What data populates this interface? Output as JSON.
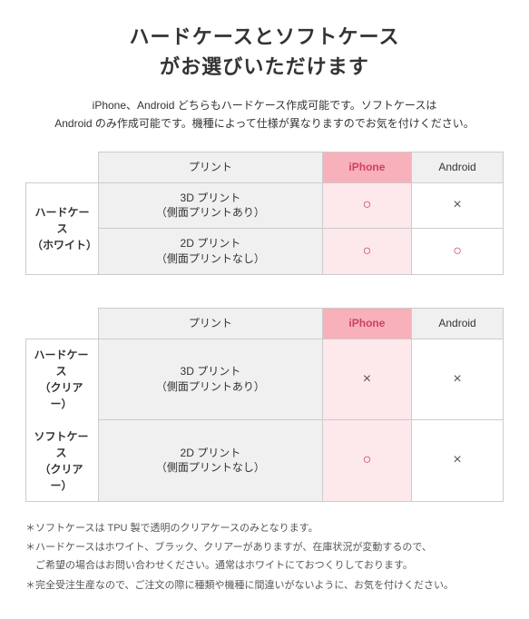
{
  "title": {
    "line1": "ハードケースとソフトケース",
    "line2": "がお選びいただけます"
  },
  "description": "iPhone、Android どちらもハードケース作成可能です。ソフトケースは\nAndroid のみ作成可能です。機種によって仕様が異なりますのでお気を付けください。",
  "table1": {
    "row_label": "ハードケース\n（ホワイト）",
    "col_print": "プリント",
    "col_iphone": "iPhone",
    "col_android": "Android",
    "rows": [
      {
        "print": "3D プリント\n（側面プリントあり）",
        "iphone": "○",
        "android": "×"
      },
      {
        "print": "2D プリント\n（側面プリントなし）",
        "iphone": "○",
        "android": "○"
      }
    ]
  },
  "table2": {
    "row_label1": "ハードケース\n（クリアー）",
    "row_label2": "ソフトケース\n（クリアー）",
    "col_print": "プリント",
    "col_iphone": "iPhone",
    "col_android": "Android",
    "rows": [
      {
        "print": "3D プリント\n（側面プリントあり）",
        "iphone": "×",
        "android": "×"
      },
      {
        "print": "2D プリント\n（側面プリントなし）",
        "iphone": "○",
        "android": "×"
      }
    ]
  },
  "notes": [
    "＊ソフトケースは TPU 製で透明のクリアケースのみとなります。",
    "＊ハードケースはホワイト、ブラック、クリアーがありますが、在庫状況が変動するので、\nご希望の場合はお問い合わせください。通常はホワイトにておつくりしております。",
    "＊完全受注生産なので、ご注文の際に種類や機種に間違いがないように、お気を付けください。"
  ]
}
